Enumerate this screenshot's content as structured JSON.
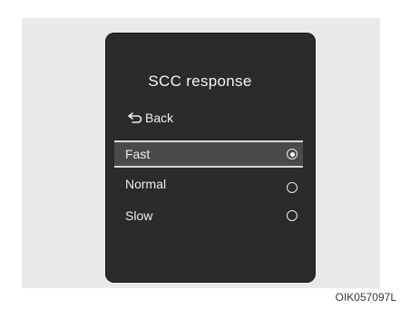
{
  "menu": {
    "title": "SCC response",
    "back_label": "Back",
    "options": [
      {
        "label": "Fast",
        "selected": true
      },
      {
        "label": "Normal",
        "selected": false
      },
      {
        "label": "Slow",
        "selected": false
      }
    ]
  },
  "figure_code": "OIK057097L",
  "colors": {
    "screen_bg": "#2b2b2b",
    "highlight_bg": "#4a4a4a",
    "text": "#eaeaea",
    "frame_bg": "#e9e9ea"
  },
  "icons": {
    "back": "back-arrow-icon",
    "radio_on": "radio-selected-icon",
    "radio_off": "radio-unselected-icon"
  }
}
